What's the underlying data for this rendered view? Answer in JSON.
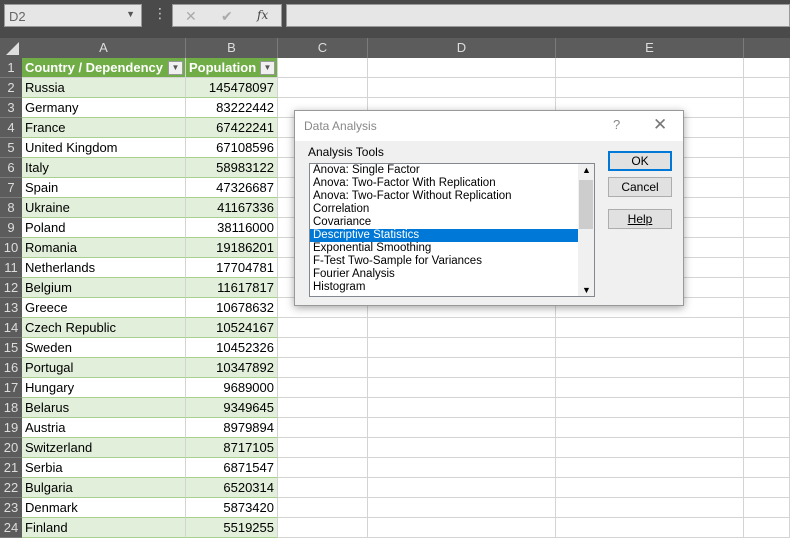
{
  "name_box": "D2",
  "formula_bar": {
    "cancel_icon": "✕",
    "enter_icon": "✔",
    "fx_icon": "fx",
    "value": ""
  },
  "columns": [
    "A",
    "B",
    "C",
    "D",
    "E"
  ],
  "table": {
    "headers": [
      "Country / Dependency",
      "Population"
    ],
    "rows": [
      [
        "Russia",
        "145478097"
      ],
      [
        "Germany",
        "83222442"
      ],
      [
        "France",
        "67422241"
      ],
      [
        "United Kingdom",
        "67108596"
      ],
      [
        "Italy",
        "58983122"
      ],
      [
        "Spain",
        "47326687"
      ],
      [
        "Ukraine",
        "41167336"
      ],
      [
        "Poland",
        "38116000"
      ],
      [
        "Romania",
        "19186201"
      ],
      [
        "Netherlands",
        "17704781"
      ],
      [
        "Belgium",
        "11617817"
      ],
      [
        "Greece",
        "10678632"
      ],
      [
        "Czech Republic",
        "10524167"
      ],
      [
        "Sweden",
        "10452326"
      ],
      [
        "Portugal",
        "10347892"
      ],
      [
        "Hungary",
        "9689000"
      ],
      [
        "Belarus",
        "9349645"
      ],
      [
        "Austria",
        "8979894"
      ],
      [
        "Switzerland",
        "8717105"
      ],
      [
        "Serbia",
        "6871547"
      ],
      [
        "Bulgaria",
        "6520314"
      ],
      [
        "Denmark",
        "5873420"
      ],
      [
        "Finland",
        "5519255"
      ]
    ]
  },
  "dialog": {
    "title": "Data Analysis",
    "help_icon": "?",
    "close_icon": "✕",
    "label": "Analysis Tools",
    "tools": [
      "Anova: Single Factor",
      "Anova: Two-Factor With Replication",
      "Anova: Two-Factor Without Replication",
      "Correlation",
      "Covariance",
      "Descriptive Statistics",
      "Exponential Smoothing",
      "F-Test Two-Sample for Variances",
      "Fourier Analysis",
      "Histogram"
    ],
    "selected_index": 5,
    "ok": "OK",
    "cancel": "Cancel",
    "help": "Help"
  }
}
